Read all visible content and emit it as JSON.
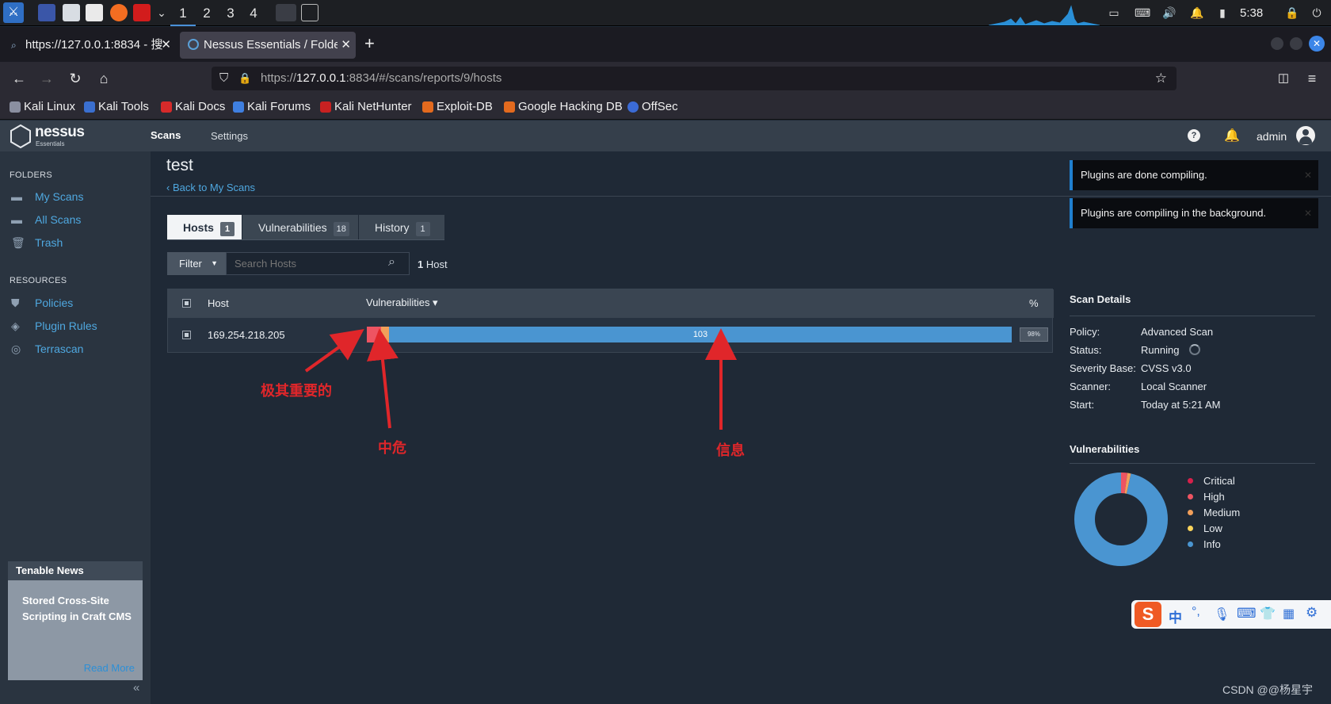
{
  "taskbar": {
    "workspaces": [
      "1",
      "2",
      "3",
      "4"
    ],
    "clock": "5:38"
  },
  "browser": {
    "tabs": [
      {
        "title": "https://127.0.0.1:8834 - 搜"
      },
      {
        "title": "Nessus Essentials / Folde"
      }
    ],
    "url_prefix": "https://",
    "url_host": "127.0.0.1",
    "url_rest": ":8834/#/scans/reports/9/hosts",
    "bookmarks": [
      "Kali Linux",
      "Kali Tools",
      "Kali Docs",
      "Kali Forums",
      "Kali NetHunter",
      "Exploit-DB",
      "Google Hacking DB",
      "OffSec"
    ]
  },
  "nessus": {
    "logo": "nessus",
    "logo_sub": "Essentials",
    "nav": {
      "scans": "Scans",
      "settings": "Settings"
    },
    "user": "admin"
  },
  "sidebar": {
    "folders_label": "FOLDERS",
    "folders": [
      "My Scans",
      "All Scans",
      "Trash"
    ],
    "resources_label": "RESOURCES",
    "resources": [
      "Policies",
      "Plugin Rules",
      "Terrascan"
    ],
    "news": {
      "title": "Tenable News",
      "headline": "Stored Cross-Site Scripting in Craft CMS",
      "link": "Read More"
    },
    "collapse": "«"
  },
  "scan": {
    "title": "test",
    "back": "Back to My Scans",
    "tabs": [
      {
        "label": "Hosts",
        "count": "1"
      },
      {
        "label": "Vulnerabilities",
        "count": "18"
      },
      {
        "label": "History",
        "count": "1"
      }
    ],
    "filter_label": "Filter",
    "search_placeholder": "Search Hosts",
    "host_count": "1",
    "host_count_label": "Host",
    "table": {
      "col_host": "Host",
      "col_vulns": "Vulnerabilities ▾",
      "col_pct": "%",
      "rows": [
        {
          "host": "169.254.218.205",
          "info_count": "103",
          "pct": "98%",
          "bar": {
            "critical": 0,
            "high": 0.022,
            "medium": 0.012,
            "low": 0,
            "info": 0.966
          }
        }
      ]
    }
  },
  "annotations": {
    "critical": "极其重要的",
    "medium": "中危",
    "info": "信息"
  },
  "toasts": [
    "Plugins are done compiling.",
    "Plugins are compiling in the background."
  ],
  "details": {
    "title": "Scan Details",
    "rows": [
      {
        "k": "Policy:",
        "v": "Advanced Scan"
      },
      {
        "k": "Status:",
        "v": "Running"
      },
      {
        "k": "Severity Base:",
        "v": "CVSS v3.0"
      },
      {
        "k": "Scanner:",
        "v": "Local Scanner"
      },
      {
        "k": "Start:",
        "v": "Today at 5:21 AM"
      }
    ]
  },
  "vulns": {
    "title": "Vulnerabilities",
    "legend": [
      {
        "label": "Critical",
        "color": "#d6204b"
      },
      {
        "label": "High",
        "color": "#ee5462"
      },
      {
        "label": "Medium",
        "color": "#f29f5a"
      },
      {
        "label": "Low",
        "color": "#fbd45b"
      },
      {
        "label": "Info",
        "color": "#4a95d1"
      }
    ],
    "donut": {
      "high": 0.022,
      "medium": 0.012,
      "info": 0.966
    }
  },
  "ime": {
    "lang": "中",
    "punct": "°,"
  },
  "watermark": "CSDN @@杨星宇"
}
